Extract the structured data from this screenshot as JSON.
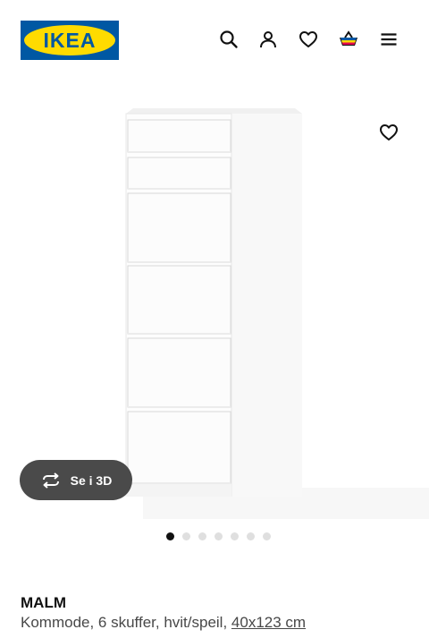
{
  "header": {
    "logo_text": "IKEA",
    "brand_colors": {
      "blue": "#0058A3",
      "yellow": "#FFDB00"
    },
    "icons": [
      "search-icon",
      "user-icon",
      "heart-icon",
      "cart-icon",
      "menu-icon"
    ]
  },
  "gallery": {
    "favourite_icon": "heart-outline-icon",
    "view_3d_label": "Se i 3D",
    "view_3d_icon": "rotate-icon",
    "image_count": 7,
    "active_image": 1
  },
  "product": {
    "name": "MALM",
    "description": "Kommode, 6 skuffer, hvit/speil, ",
    "size_link": "40x123 cm"
  }
}
